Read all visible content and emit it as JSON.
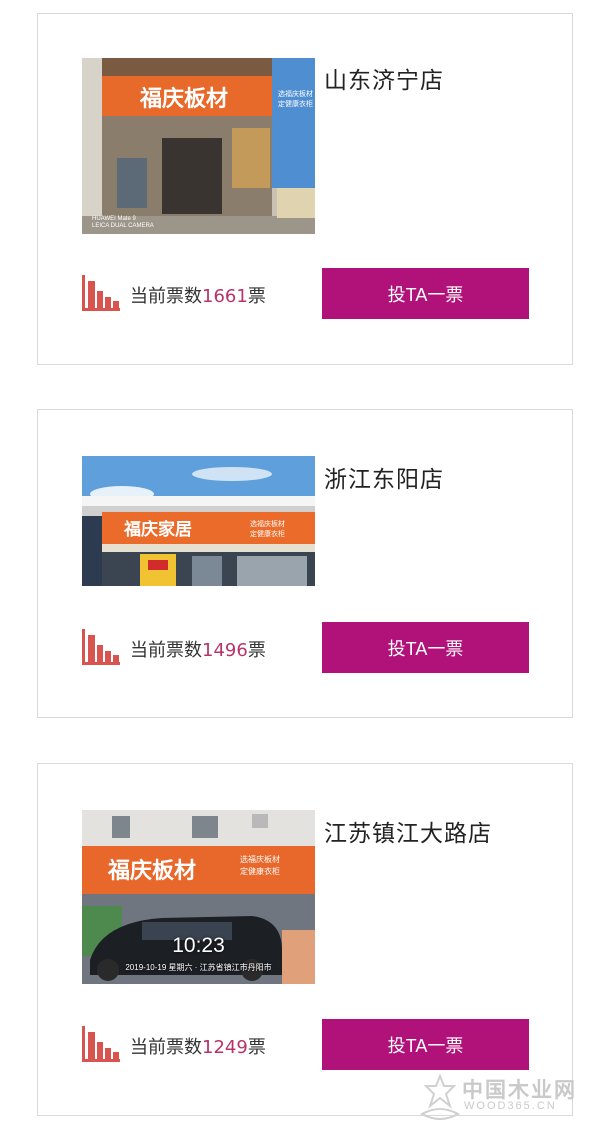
{
  "stores": [
    {
      "name": "山东济宁店",
      "vote_prefix": "当前票数",
      "vote_count": "1661",
      "vote_suffix": "票",
      "button_label": "投TA一票",
      "photo": {
        "sign_main": "福庆板材",
        "sign_side": "选福庆板材",
        "sign_side2": "定健康衣柜",
        "camera_line1": "HUAWEI Mate 9",
        "camera_line2": "LEICA DUAL CAMERA"
      }
    },
    {
      "name": "浙江东阳店",
      "vote_prefix": "当前票数",
      "vote_count": "1496",
      "vote_suffix": "票",
      "button_label": "投TA一票",
      "photo": {
        "sign_main": "福庆家居",
        "sign_side": "选福庆板材",
        "sign_side2": "定健康衣柜"
      }
    },
    {
      "name": "江苏镇江大路店",
      "vote_prefix": "当前票数",
      "vote_count": "1249",
      "vote_suffix": "票",
      "button_label": "投TA一票",
      "photo": {
        "sign_main": "福庆板材",
        "sign_side": "选福庆板材",
        "sign_side2": "定健康衣柜",
        "time": "10:23",
        "date": "2019-10-19 星期六 · 江苏省镇江市丹阳市"
      }
    }
  ],
  "colors": {
    "button": "#b0127a",
    "vote_count": "#b8336a",
    "icon": "#d9534f"
  },
  "watermark": {
    "cn": "中国木业网",
    "en": "WOOD365.CN"
  }
}
